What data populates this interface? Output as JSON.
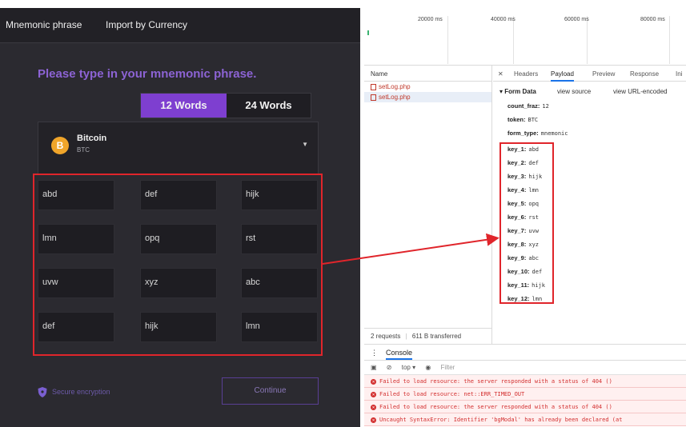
{
  "app": {
    "tabs": [
      "Mnemonic phrase",
      "Import by Currency"
    ],
    "heading": "Please type in your mnemonic phrase.",
    "word_toggle": [
      "12 Words",
      "24 Words"
    ],
    "currency": {
      "name": "Bitcoin",
      "code": "BTC",
      "icon_letter": "B"
    },
    "words": [
      "abd",
      "def",
      "hijk",
      "lmn",
      "opq",
      "rst",
      "uvw",
      "xyz",
      "abc",
      "def",
      "hijk",
      "lmn"
    ],
    "secure_label": "Secure encryption",
    "continue_label": "Continue",
    "colors": {
      "accent": "#7e3fd0",
      "heading": "#8c63d4",
      "btc": "#f0a52a",
      "highlight": "#e0252b"
    }
  },
  "devtools": {
    "timeline_ticks": [
      "20000 ms",
      "40000 ms",
      "60000 ms",
      "80000 ms"
    ],
    "list": {
      "header": "Name",
      "requests": [
        "setLog.php",
        "setLog.php"
      ],
      "footer": [
        "2 requests",
        "611 B transferred"
      ]
    },
    "detail_tabs": [
      "Headers",
      "Payload",
      "Preview",
      "Response",
      "Ini"
    ],
    "form_data": {
      "title": "Form Data",
      "view_source": "view source",
      "view_url": "view URL-encoded",
      "fields": [
        {
          "k": "count_fraz:",
          "v": "12"
        },
        {
          "k": "token:",
          "v": "BTC"
        },
        {
          "k": "form_type:",
          "v": "mnemonic"
        },
        {
          "k": "key_1:",
          "v": "abd"
        },
        {
          "k": "key_2:",
          "v": "def"
        },
        {
          "k": "key_3:",
          "v": "hijk"
        },
        {
          "k": "key_4:",
          "v": "lmn"
        },
        {
          "k": "key_5:",
          "v": "opq"
        },
        {
          "k": "key_6:",
          "v": "rst"
        },
        {
          "k": "key_7:",
          "v": "uvw"
        },
        {
          "k": "key_8:",
          "v": "xyz"
        },
        {
          "k": "key_9:",
          "v": "abc"
        },
        {
          "k": "key_10:",
          "v": "def"
        },
        {
          "k": "key_11:",
          "v": "hijk"
        },
        {
          "k": "key_12:",
          "v": "lmn"
        }
      ]
    },
    "console": {
      "tab": "Console",
      "context": "top ▾",
      "filter_placeholder": "Filter",
      "errors": [
        "Failed to load resource: the server responded with a status of 404 ()",
        "Failed to load resource: net::ERR_TIMED_OUT",
        "Failed to load resource: the server responded with a status of 404 ()",
        "Uncaught SyntaxError: Identifier 'bgModal' has already been declared (at"
      ]
    }
  }
}
